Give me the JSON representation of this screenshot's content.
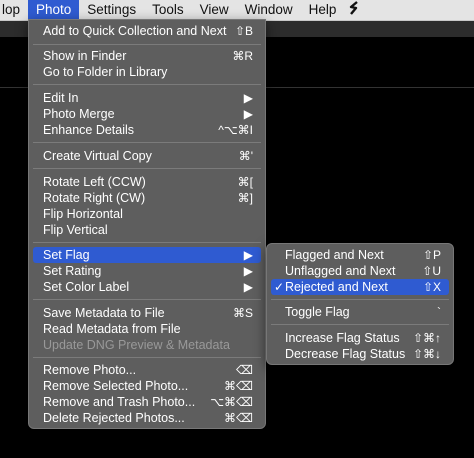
{
  "menubar": {
    "items": [
      {
        "label": "lop",
        "active": false
      },
      {
        "label": "Photo",
        "active": true
      },
      {
        "label": "Settings",
        "active": false
      },
      {
        "label": "Tools",
        "active": false
      },
      {
        "label": "View",
        "active": false
      },
      {
        "label": "Window",
        "active": false
      },
      {
        "label": "Help",
        "active": false
      }
    ],
    "script_icon": "script-s-icon"
  },
  "photo_menu": {
    "items": [
      {
        "label": "Add to Quick Collection and Next",
        "shortcut": "⇧B"
      },
      {
        "label": "Show in Finder",
        "shortcut": "⌘R"
      },
      {
        "label": "Go to Folder in Library",
        "shortcut": ""
      },
      {
        "label": "Edit In",
        "shortcut": "▶"
      },
      {
        "label": "Photo Merge",
        "shortcut": "▶"
      },
      {
        "label": "Enhance Details",
        "shortcut": "^⌥⌘I"
      },
      {
        "label": "Create Virtual Copy",
        "shortcut": "⌘'"
      },
      {
        "label": "Rotate Left (CCW)",
        "shortcut": "⌘["
      },
      {
        "label": "Rotate Right (CW)",
        "shortcut": "⌘]"
      },
      {
        "label": "Flip Horizontal",
        "shortcut": ""
      },
      {
        "label": "Flip Vertical",
        "shortcut": ""
      },
      {
        "label": "Set Flag",
        "shortcut": "▶"
      },
      {
        "label": "Set Rating",
        "shortcut": "▶"
      },
      {
        "label": "Set Color Label",
        "shortcut": "▶"
      },
      {
        "label": "Save Metadata to File",
        "shortcut": "⌘S"
      },
      {
        "label": "Read Metadata from File",
        "shortcut": ""
      },
      {
        "label": "Update DNG Preview & Metadata",
        "shortcut": ""
      },
      {
        "label": "Remove Photo...",
        "shortcut": "⌫"
      },
      {
        "label": "Remove Selected Photo...",
        "shortcut": "⌘⌫"
      },
      {
        "label": "Remove and Trash Photo...",
        "shortcut": "⌥⌘⌫"
      },
      {
        "label": "Delete Rejected Photos...",
        "shortcut": "⌘⌫"
      }
    ]
  },
  "flag_submenu": {
    "items": [
      {
        "label": "Flagged and Next",
        "shortcut": "⇧P"
      },
      {
        "label": "Unflagged and Next",
        "shortcut": "⇧U"
      },
      {
        "label": "Rejected and Next",
        "shortcut": "⇧X",
        "checked": true
      },
      {
        "label": "Toggle Flag",
        "shortcut": "`"
      },
      {
        "label": "Increase Flag Status",
        "shortcut": "⇧⌘↑"
      },
      {
        "label": "Decrease Flag Status",
        "shortcut": "⇧⌘↓"
      }
    ],
    "check_mark": "✓"
  },
  "colors": {
    "highlight": "#2f5bd1",
    "menu_bg": "#5e5e5e",
    "menubar_bg": "#e4e4e4"
  }
}
